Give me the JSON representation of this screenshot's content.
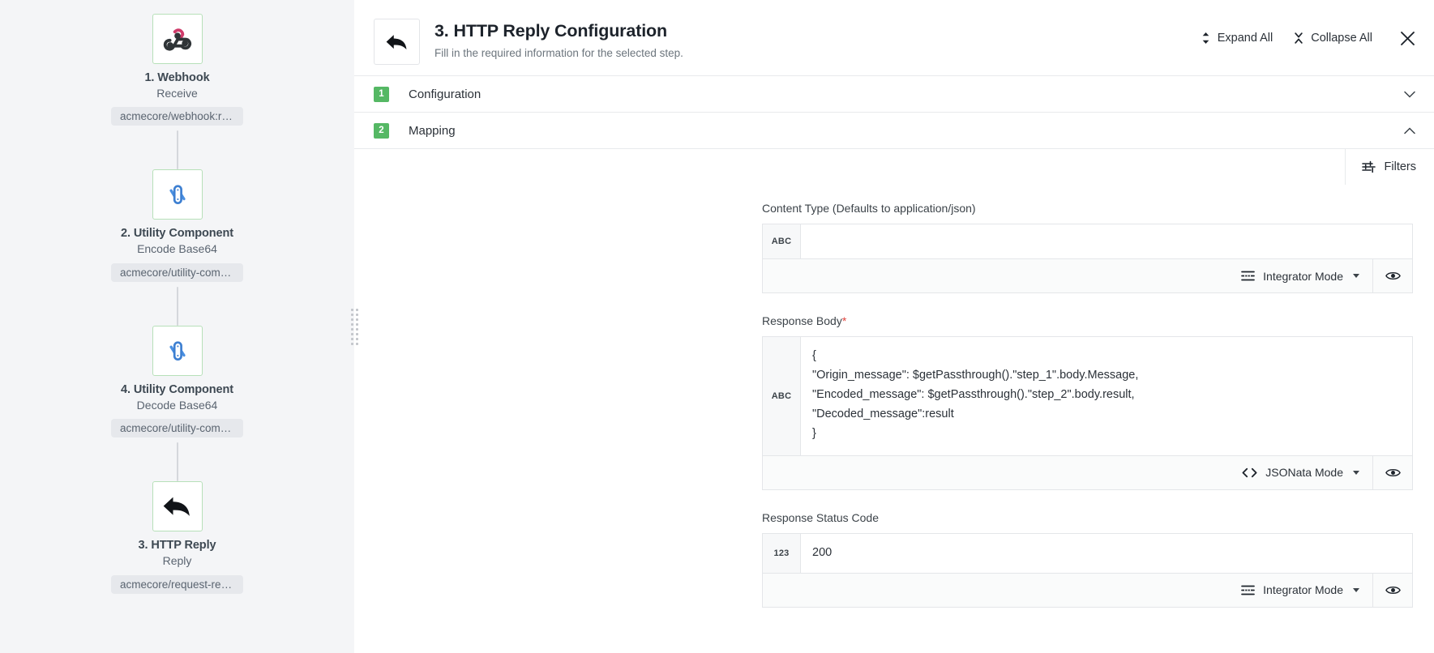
{
  "flow": {
    "nodes": [
      {
        "icon": "webhook-icon",
        "title": "1. Webhook",
        "subtitle": "Receive",
        "pill": "acmecore/webhook:recei..."
      },
      {
        "icon": "utility-component-icon",
        "title": "2. Utility Component",
        "subtitle": "Encode Base64",
        "pill": "acmecore/utility-compo..."
      },
      {
        "icon": "utility-component-icon",
        "title": "4. Utility Component",
        "subtitle": "Decode Base64",
        "pill": "acmecore/utility-compo..."
      },
      {
        "icon": "reply-arrow-icon",
        "title": "3. HTTP Reply",
        "subtitle": "Reply",
        "pill": "acmecore/request-reply:..."
      }
    ]
  },
  "header": {
    "back_icon": "back-arrow-icon",
    "title": "3. HTTP Reply Configuration",
    "subtitle": "Fill in the required information for the selected step.",
    "expand_all": "Expand All",
    "collapse_all": "Collapse All",
    "expand_icon": "expand-vertical-icon",
    "collapse_icon": "collapse-vertical-icon",
    "close_icon": "close-icon"
  },
  "sections": [
    {
      "number": "1",
      "label": "Configuration",
      "expanded": false,
      "chevron": "chevron-down-icon"
    },
    {
      "number": "2",
      "label": "Mapping",
      "expanded": true,
      "chevron": "chevron-up-icon"
    }
  ],
  "toolbar": {
    "filters_label": "Filters",
    "filters_icon": "sliders-icon"
  },
  "fields": [
    {
      "label": "Content Type (Defaults to application/json)",
      "required": false,
      "type_tag": "ABC",
      "value": "",
      "mode_label": "Integrator Mode",
      "mode_icon": "integrator-mode-icon",
      "eye_icon": "eye-icon"
    },
    {
      "label": "Response Body",
      "required": true,
      "type_tag": "ABC",
      "value": "{\n\"Origin_message\": $getPassthrough().\"step_1\".body.Message,\n\"Encoded_message\": $getPassthrough().\"step_2\".body.result,\n\"Decoded_message\":result\n}",
      "mode_label": "JSONata Mode",
      "mode_icon": "code-brackets-icon",
      "eye_icon": "eye-icon"
    },
    {
      "label": "Response Status Code",
      "required": false,
      "type_tag": "123",
      "value": "200",
      "mode_label": "Integrator Mode",
      "mode_icon": "integrator-mode-icon",
      "eye_icon": "eye-icon"
    }
  ],
  "colors": {
    "accent_green": "#55b864",
    "required_red": "#e0443e",
    "webhook_pink": "#cf3b6a",
    "utility_blue": "#4a90e2"
  }
}
